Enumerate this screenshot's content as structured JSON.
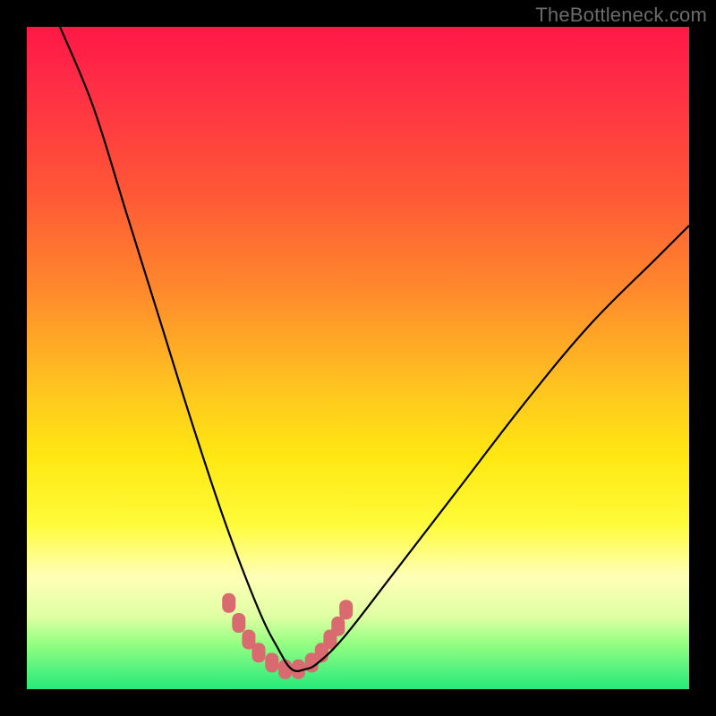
{
  "watermark": "TheBottleneck.com",
  "chart_data": {
    "type": "line",
    "title": "",
    "xlabel": "",
    "ylabel": "",
    "xlim": [
      0,
      100
    ],
    "ylim": [
      0,
      100
    ],
    "series": [
      {
        "name": "bottleneck-curve",
        "x": [
          5,
          10,
          15,
          20,
          25,
          30,
          35,
          38,
          40,
          42,
          44,
          48,
          55,
          65,
          75,
          85,
          95,
          100
        ],
        "y": [
          100,
          88,
          72,
          56,
          40,
          25,
          12,
          6,
          3,
          3,
          4,
          8,
          17,
          30,
          43,
          55,
          65,
          70
        ]
      }
    ],
    "trough_markers": {
      "x": [
        30.5,
        32,
        33.5,
        35,
        37,
        39,
        41,
        43,
        44.5,
        45.8,
        47,
        48.2
      ],
      "y": [
        13,
        10,
        7.5,
        5.5,
        4,
        3,
        3,
        4,
        5.5,
        7.5,
        9.5,
        12
      ]
    },
    "background_gradient": {
      "top": "#ff1846",
      "mid": "#fff033",
      "bottom": "#26e97a"
    }
  }
}
